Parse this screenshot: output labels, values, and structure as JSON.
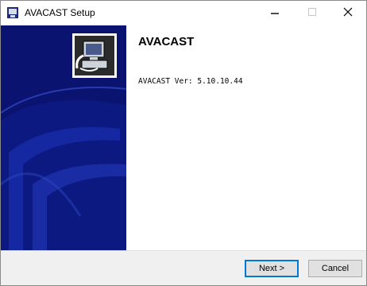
{
  "window": {
    "title": "AVACAST Setup",
    "icons": {
      "app": "installer-icon",
      "minimize": "minimize-icon",
      "maximize": "maximize-icon",
      "close": "close-icon"
    }
  },
  "header": {
    "heading": "AVACAST",
    "version": "AVACAST Ver: 5.10.10.44"
  },
  "sidebar": {
    "product_icon": "computer-install-icon",
    "background_color": "#0a1470"
  },
  "footer": {
    "next_label": "Next >",
    "cancel_label": "Cancel"
  }
}
